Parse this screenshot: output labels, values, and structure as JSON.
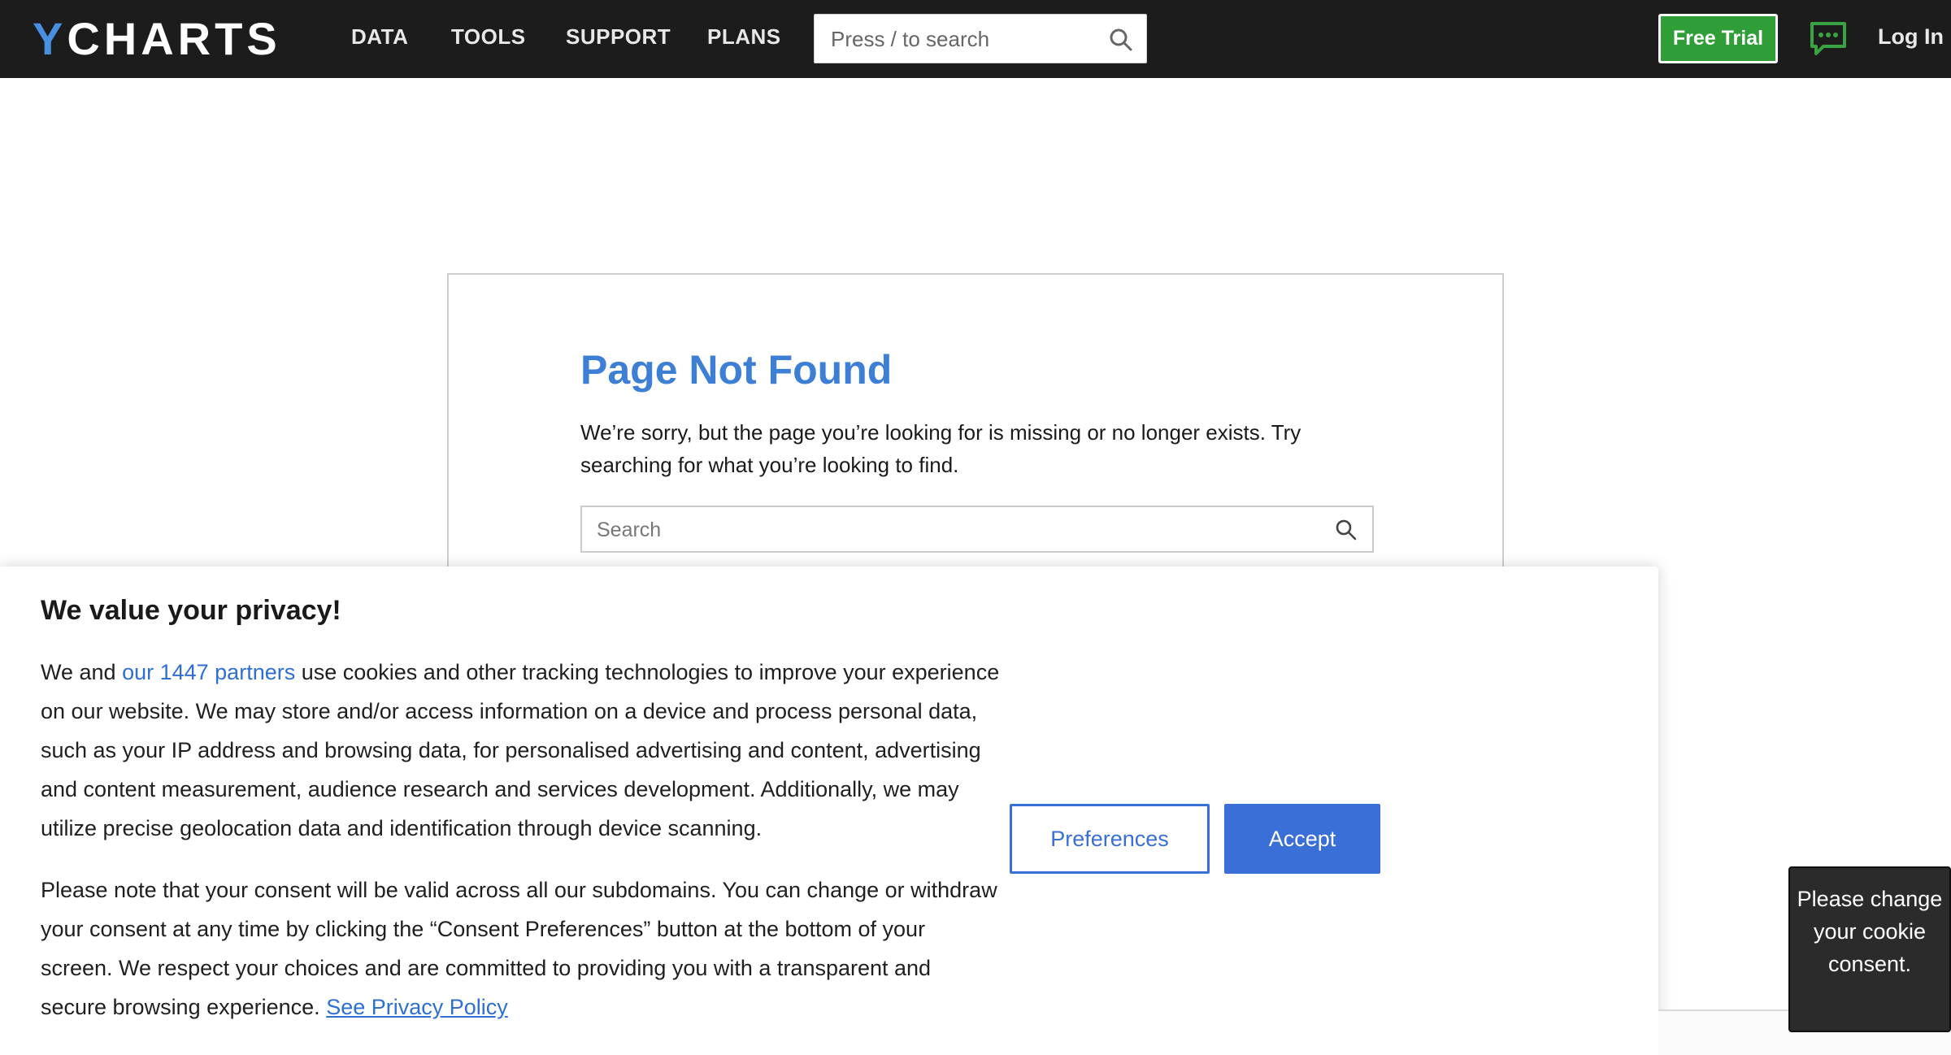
{
  "header": {
    "logo_y": "Y",
    "logo_rest": "CHARTS",
    "nav": [
      {
        "label": "DATA"
      },
      {
        "label": "TOOLS"
      },
      {
        "label": "SUPPORT"
      },
      {
        "label": "PLANS"
      }
    ],
    "search_placeholder": "Press / to search",
    "free_trial": "Free Trial",
    "login": "Log In"
  },
  "not_found": {
    "title": "Page Not Found",
    "message": "We’re sorry, but the page you’re looking for is missing or no longer exists. Try searching for what you’re looking to find.",
    "search_placeholder": "Search"
  },
  "cookie": {
    "title": "We value your privacy!",
    "p1_before": "We and ",
    "p1_link": "our 1447 partners",
    "p1_after": " use cookies and other tracking technologies to improve your experience on our website. We may store and/or access information on a device and process personal data, such as your IP address and browsing data, for personalised advertising and content, advertising and content measurement, audience research and services development. Additionally, we may utilize precise geolocation data and identification through device scanning.",
    "p2": "Please note that your consent will be valid across all our subdomains. You can change or withdraw your consent at any time by clicking the “Consent Preferences” button at the bottom of your screen. We respect your choices and are committed to providing you with a transparent and secure browsing experience. ",
    "p2_link": "See Privacy Policy",
    "preferences": "Preferences",
    "accept": "Accept"
  },
  "tooltip": {
    "text": "Please change your cookie consent."
  },
  "colors": {
    "nav_bg": "#1c1c1c",
    "brand_blue": "#3e7fd6",
    "trial_green": "#2f9e37",
    "accept_blue": "#3b6fd8"
  },
  "icons": [
    "search-icon",
    "chat-icon"
  ]
}
